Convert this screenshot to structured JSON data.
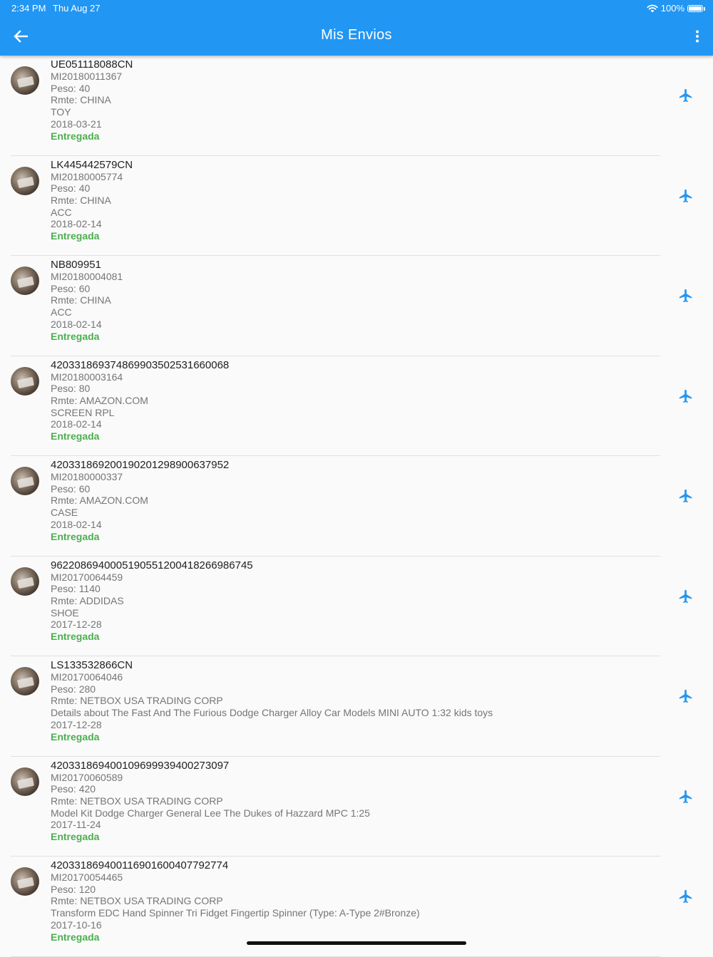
{
  "status_bar": {
    "time": "2:34 PM",
    "date": "Thu Aug 27",
    "battery": "100%",
    "battery_level": 1.0
  },
  "app_bar": {
    "title": "Mis Envios",
    "back_icon": "arrow-left-icon",
    "menu_icon": "more-vertical-icon"
  },
  "colors": {
    "primary": "#2196f3",
    "status_delivered": "#4caf50",
    "plane_icon": "#2196f3"
  },
  "shipments": [
    {
      "tracking": "UE051118088CN",
      "id": "MI20180011367",
      "peso": "Peso: 40",
      "remitente": "Rmte: CHINA",
      "contenido": "TOY",
      "fecha": "2018-03-21",
      "estado": "Entregada"
    },
    {
      "tracking": "LK445442579CN",
      "id": "MI20180005774",
      "peso": "Peso: 40",
      "remitente": "Rmte: CHINA",
      "contenido": "ACC",
      "fecha": "2018-02-14",
      "estado": "Entregada"
    },
    {
      "tracking": "NB809951",
      "id": "MI20180004081",
      "peso": "Peso: 60",
      "remitente": "Rmte: CHINA",
      "contenido": "ACC",
      "fecha": "2018-02-14",
      "estado": "Entregada"
    },
    {
      "tracking": "420331869374869903502531660068",
      "id": "MI20180003164",
      "peso": "Peso: 80",
      "remitente": "Rmte: AMAZON.COM",
      "contenido": "SCREEN RPL",
      "fecha": "2018-02-14",
      "estado": "Entregada"
    },
    {
      "tracking": "420331869200190201298900637952",
      "id": "MI20180000337",
      "peso": "Peso: 60",
      "remitente": "Rmte: AMAZON.COM",
      "contenido": "CASE",
      "fecha": "2018-02-14",
      "estado": "Entregada"
    },
    {
      "tracking": "9622086940005190551200418266986745",
      "id": "MI20170064459",
      "peso": "Peso: 1140",
      "remitente": "Rmte: ADDIDAS",
      "contenido": "SHOE",
      "fecha": "2017-12-28",
      "estado": "Entregada"
    },
    {
      "tracking": "LS133532866CN",
      "id": "MI20170064046",
      "peso": "Peso: 280",
      "remitente": "Rmte: NETBOX USA TRADING CORP",
      "contenido": "Details about  The Fast And The Furious Dodge Charger Alloy Car Models MINI AUTO 1:32 kids toys",
      "fecha": "2017-12-28",
      "estado": "Entregada"
    },
    {
      "tracking": "420331869400109699939400273097",
      "id": "MI20170060589",
      "peso": "Peso: 420",
      "remitente": "Rmte: NETBOX USA TRADING CORP",
      "contenido": "Model Kit Dodge Charger General Lee The Dukes of Hazzard MPC 1:25",
      "fecha": "2017-11-24",
      "estado": "Entregada"
    },
    {
      "tracking": "420331869400116901600407792774",
      "id": "MI20170054465",
      "peso": "Peso: 120",
      "remitente": "Rmte: NETBOX USA TRADING CORP",
      "contenido": "Transform EDC Hand Spinner Tri Fidget Fingertip Spinner (Type: A-Type 2#Bronze)",
      "fecha": "2017-10-16",
      "estado": "Entregada"
    }
  ],
  "row_icon": "airplane-icon",
  "avatar_icon": "package-photo-avatar"
}
